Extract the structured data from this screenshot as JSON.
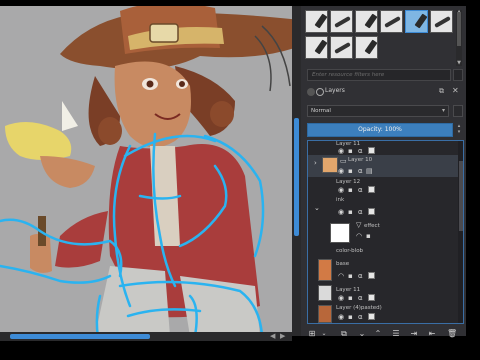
{
  "brush_presets": {
    "items": [
      "brush-1",
      "brush-2",
      "brush-3",
      "brush-4",
      "brush-5",
      "brush-6",
      "brush-7",
      "brush-8",
      "brush-9"
    ],
    "selected_index": 4
  },
  "filter": {
    "placeholder": "Enter resource filters here"
  },
  "layers_docker": {
    "title": "Layers",
    "blend_mode": "Normal",
    "opacity": "Opacity: 100%"
  },
  "layers": [
    {
      "name": "Layer 11",
      "kind": "paint"
    },
    {
      "name": "Layer 10",
      "kind": "paint"
    },
    {
      "name": "Layer 12",
      "kind": "paint"
    },
    {
      "name": "ink",
      "kind": "group"
    },
    {
      "name": "effect",
      "kind": "filter"
    },
    {
      "name": "color-blob",
      "kind": "paint"
    },
    {
      "name": "base",
      "kind": "paint"
    },
    {
      "name": "Layer 11",
      "kind": "paint"
    },
    {
      "name": "Layer (4)pasted)",
      "kind": "paint"
    }
  ],
  "bottom_toolbar": [
    "add-layer",
    "dropdown",
    "duplicate",
    "move-down",
    "move-up",
    "properties",
    "import",
    "export",
    "delete"
  ],
  "colors": {
    "accent": "#3c7fbd",
    "canvas_bg": "#a9a9aa",
    "panel_bg": "#303034",
    "sketch_lines": "#2ab3f0"
  }
}
